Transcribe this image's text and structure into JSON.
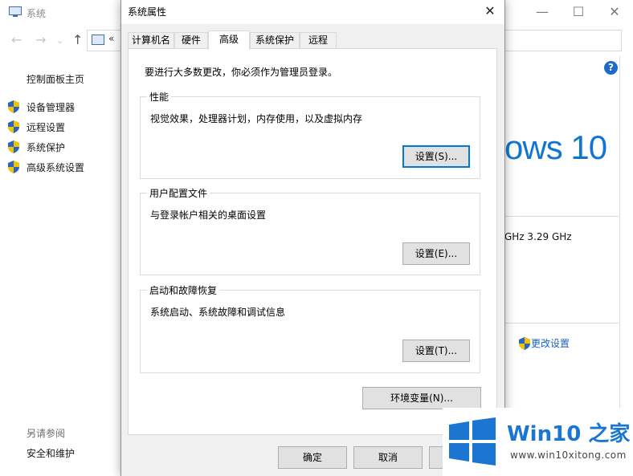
{
  "background_window": {
    "title": "系统",
    "controls": {
      "minimize": "—",
      "maximize": "☐",
      "close": "✕"
    },
    "address_text": "«",
    "sidebar_home": "控制面板主页",
    "sidebar_items": [
      {
        "label": "设备管理器"
      },
      {
        "label": "远程设置"
      },
      {
        "label": "系统保护"
      },
      {
        "label": "高级系统设置"
      }
    ],
    "see_also": "另请参阅",
    "security_link": "安全和维护",
    "help_glyph": "?",
    "windows_text": "ows 10",
    "cpu_text": "GHz   3.29 GHz",
    "change_settings": "更改设置"
  },
  "dialog": {
    "title": "系统属性",
    "close_glyph": "✕",
    "tabs": [
      {
        "label": "计算机名"
      },
      {
        "label": "硬件"
      },
      {
        "label": "高级"
      },
      {
        "label": "系统保护"
      },
      {
        "label": "远程"
      }
    ],
    "admin_note": "要进行大多数更改，你必须作为管理员登录。",
    "groups": {
      "performance": {
        "title": "性能",
        "desc": "视觉效果，处理器计划，内存使用，以及虚拟内存",
        "button": "设置(S)..."
      },
      "profiles": {
        "title": "用户配置文件",
        "desc": "与登录帐户相关的桌面设置",
        "button": "设置(E)..."
      },
      "startup": {
        "title": "启动和故障恢复",
        "desc": "系统启动、系统故障和调试信息",
        "button": "设置(T)..."
      }
    },
    "env_button": "环境变量(N)...",
    "ok_button": "确定",
    "cancel_button": "取消"
  },
  "watermark": {
    "name": "Win10 之家",
    "url": "www.win10xitong.com"
  },
  "colors": {
    "accent": "#0078d7",
    "shield_blue": "#2b64c4",
    "shield_yellow": "#f2c400",
    "win_blue": "#1176d2"
  }
}
